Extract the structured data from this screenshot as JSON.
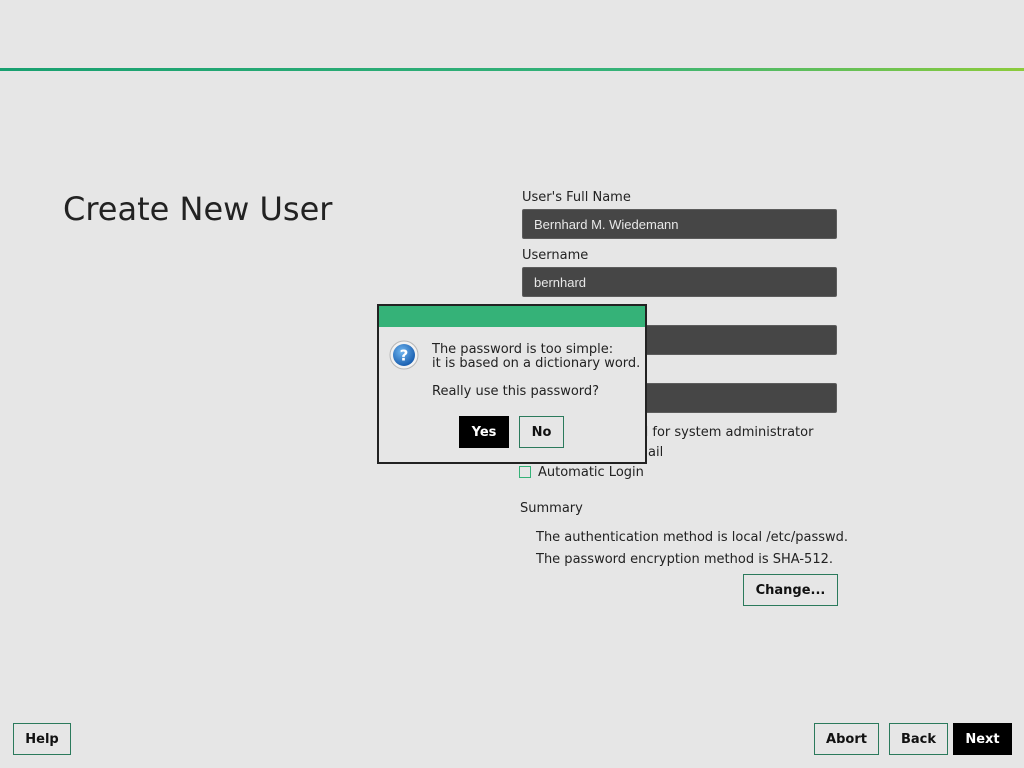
{
  "header": {
    "accent_gradient": [
      "#18a070",
      "#35b278",
      "#8ccb3c"
    ]
  },
  "page": {
    "title": "Create New User"
  },
  "form": {
    "fullname_label": "User's Full Name",
    "fullname_value": "Bernhard M. Wiedemann",
    "username_label": "Username",
    "username_value": "bernhard",
    "checkbox_admin_partial": "d for system administrator",
    "checkbox_mail_partial": "ail",
    "autologin_label": "Automatic Login"
  },
  "summary": {
    "heading": "Summary",
    "line1": "The authentication method is local /etc/passwd.",
    "line2": "The password encryption method is SHA-512.",
    "change_label": "Change..."
  },
  "dialog": {
    "line1": "The password is too simple:",
    "line2": "it is based on a dictionary word.",
    "question": "Really use this password?",
    "yes_label": "Yes",
    "no_label": "No",
    "icon": "question-icon"
  },
  "footer": {
    "help_label": "Help",
    "abort_label": "Abort",
    "back_label": "Back",
    "next_label": "Next"
  },
  "colors": {
    "accent": "#35b278",
    "field_bg": "#464646",
    "background": "#e6e6e6"
  }
}
